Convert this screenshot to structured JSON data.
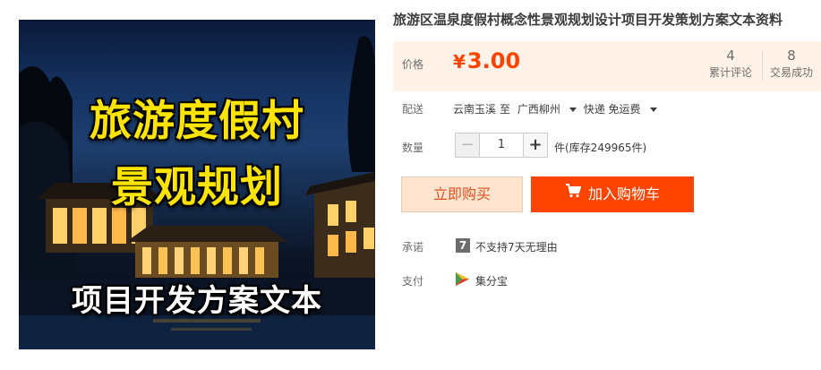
{
  "product": {
    "title": "旅游区温泉度假村概念性景观规划设计项目开发策划方案文本资料",
    "image": {
      "line1": "旅游度假村",
      "line2": "景观规划",
      "line3": "项目开发方案文本"
    }
  },
  "price": {
    "label": "价格",
    "currency": "¥",
    "value": "3.00"
  },
  "stats": {
    "reviews_count": "4",
    "reviews_label": "累计评论",
    "deals_count": "8",
    "deals_label": "交易成功"
  },
  "delivery": {
    "label": "配送",
    "from": "云南玉溪",
    "to_word": "至",
    "destination": "广西柳州",
    "method": "快递 免运费"
  },
  "quantity": {
    "label": "数量",
    "value": "1",
    "minus": "−",
    "plus": "+",
    "stock": "件(库存249965件)"
  },
  "buttons": {
    "buy_now": "立即购买",
    "add_to_cart": "加入购物车"
  },
  "promise": {
    "label": "承诺",
    "icon_text": "7",
    "text": "不支持7天无理由"
  },
  "payment": {
    "label": "支付",
    "method": "集分宝"
  },
  "colors": {
    "accent": "#ff4400",
    "price_bg": "#fff2e8",
    "buy_bg": "#ffe4d0",
    "headline_yellow": "#ffe400"
  }
}
